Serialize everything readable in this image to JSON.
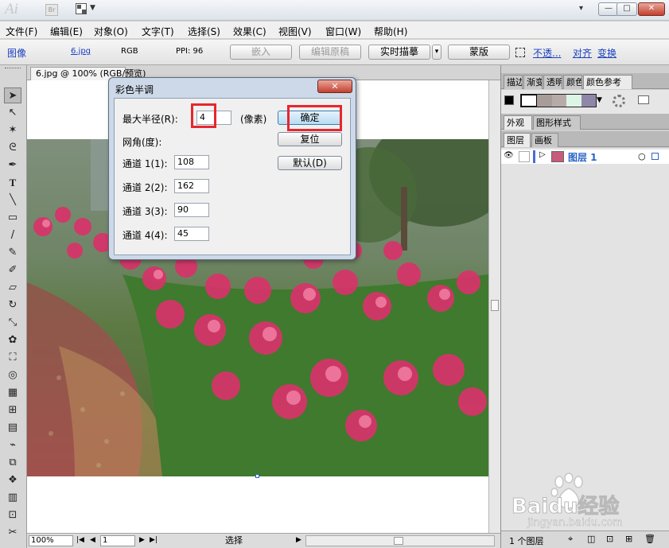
{
  "app": {
    "logo": "Ai",
    "bridge_badge": "Br",
    "window_controls": {
      "workspace_drop": "▾",
      "minimize": "—",
      "maximize": "□",
      "close": "✕"
    }
  },
  "menu": [
    "文件(F)",
    "编辑(E)",
    "对象(O)",
    "文字(T)",
    "选择(S)",
    "效果(C)",
    "视图(V)",
    "窗口(W)",
    "帮助(H)"
  ],
  "control_bar": {
    "type_label": "图像",
    "file_name": "6.jpg",
    "color_mode": "RGB",
    "ppi": "PPI: 96",
    "embed": "嵌入",
    "edit_original": "编辑原稿",
    "live_trace": "实时描摹",
    "trace_arrow": "▾",
    "mask": "蒙版",
    "opacity": "不透...",
    "align": "对齐",
    "transform": "变换"
  },
  "document": {
    "tab_title": "6.jpg @ 100% (RGB/预览)"
  },
  "dialog": {
    "title": "彩色半调",
    "close": "✕",
    "max_radius_label": "最大半径(R):",
    "max_radius_value": "4",
    "unit": "(像素)",
    "screen_angles_label": "网角(度):",
    "channels": [
      {
        "label": "通道 1(1):",
        "value": "108"
      },
      {
        "label": "通道 2(2):",
        "value": "162"
      },
      {
        "label": "通道 3(3):",
        "value": "90"
      },
      {
        "label": "通道 4(4):",
        "value": "45"
      }
    ],
    "ok": "确定",
    "reset": "复位",
    "default": "默认(D)"
  },
  "status_bar": {
    "zoom": "100%",
    "page": "1",
    "tool": "选择"
  },
  "panels": {
    "top_tabs": [
      "描边",
      "渐变",
      "透明",
      "颜色",
      "颜色参考"
    ],
    "mid_tabs": [
      "外观",
      "图形样式"
    ],
    "layer_tabs": [
      "图层",
      "画板"
    ],
    "layer_name": "图层 1",
    "layer_count": "1 个图层"
  },
  "watermark": {
    "brand": "Baidu经验",
    "url": "jingyan.baidu.com"
  },
  "colors": {
    "accent_blue": "#2b64c8",
    "highlight_red": "#e8262d",
    "panel_bg": "#cfcfcf"
  }
}
